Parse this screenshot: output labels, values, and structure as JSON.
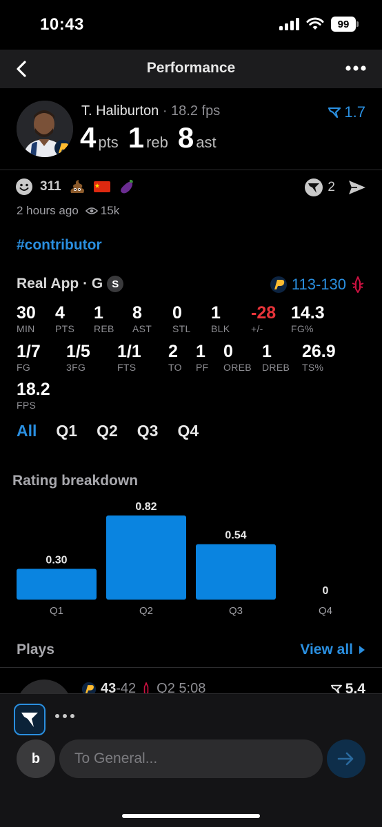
{
  "status_bar": {
    "time": "10:43",
    "battery": "99"
  },
  "nav": {
    "title": "Performance"
  },
  "player": {
    "name": "T. Haliburton",
    "fps_text": " · 18.2 fps",
    "points": "4",
    "points_label": "pts",
    "rebounds": "1",
    "rebounds_label": "reb",
    "assists": "8",
    "assists_label": "ast",
    "rating": "1.7"
  },
  "reactions": {
    "smiley_count": "311",
    "emojis": [
      "poop-emoji",
      "china-flag-emoji",
      "eggplant-emoji"
    ],
    "comment_count": "2"
  },
  "meta": {
    "time_ago": "2 hours ago",
    "views": "15k"
  },
  "hashtag": "#contributor",
  "game": {
    "label": "Real App · G",
    "badge": "S",
    "score_home": "113",
    "score_sep": "-",
    "score_away": "130"
  },
  "stats": [
    {
      "v": "30",
      "k": "MIN"
    },
    {
      "v": "4",
      "k": "PTS"
    },
    {
      "v": "1",
      "k": "REB"
    },
    {
      "v": "8",
      "k": "AST"
    },
    {
      "v": "0",
      "k": "STL"
    },
    {
      "v": "1",
      "k": "BLK"
    },
    {
      "v": "-28",
      "k": "+/-"
    },
    {
      "v": "14.3",
      "k": "FG%"
    },
    {
      "v": "1/7",
      "k": "FG"
    },
    {
      "v": "1/5",
      "k": "3FG"
    },
    {
      "v": "1/1",
      "k": "FTS"
    },
    {
      "v": "2",
      "k": "TO"
    },
    {
      "v": "1",
      "k": "PF"
    },
    {
      "v": "0",
      "k": "OREB"
    },
    {
      "v": "1",
      "k": "DREB"
    },
    {
      "v": "26.9",
      "k": "TS%"
    },
    {
      "v": "18.2",
      "k": "FPS"
    }
  ],
  "quarter_tabs": [
    "All",
    "Q1",
    "Q2",
    "Q3",
    "Q4"
  ],
  "active_tab": "All",
  "rating_breakdown_title": "Rating breakdown",
  "chart_data": {
    "type": "bar",
    "title": "Rating breakdown",
    "categories": [
      "Q1",
      "Q2",
      "Q3",
      "Q4"
    ],
    "values": [
      0.3,
      0.82,
      0.54,
      0
    ],
    "value_labels": [
      "0.30",
      "0.82",
      "0.54",
      "0"
    ],
    "xlabel": "",
    "ylabel": "",
    "ylim": [
      0,
      0.82
    ],
    "grid": false,
    "bar_color": "#0a84e0"
  },
  "plays": {
    "title": "Plays",
    "view_all": "View all",
    "first": {
      "score_home": "43",
      "score_away": "42",
      "time": "Q2 5:08",
      "rating": "5.4"
    }
  },
  "composer": {
    "avatar_letter": "b",
    "placeholder": "To General..."
  },
  "colors": {
    "accent": "#2a8fe0",
    "negative": "#e8343a",
    "background": "#000000",
    "bar": "#0a84e0"
  }
}
